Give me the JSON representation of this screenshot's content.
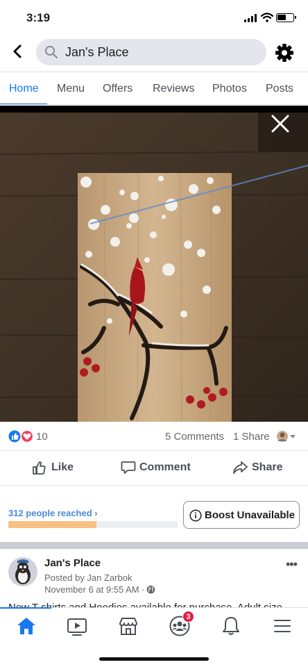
{
  "status_bar": {
    "time": "3:19"
  },
  "header": {
    "search_text": "Jan's Place",
    "icons": [
      "chevron-left-icon",
      "search-icon",
      "gear-icon"
    ]
  },
  "tabs": [
    {
      "label": "Home",
      "active": true
    },
    {
      "label": "Menu",
      "active": false
    },
    {
      "label": "Offers",
      "active": false
    },
    {
      "label": "Reviews",
      "active": false
    },
    {
      "label": "Photos",
      "active": false
    },
    {
      "label": "Posts",
      "active": false
    }
  ],
  "photo": {
    "close_icon": "close-icon"
  },
  "reactions": {
    "count": "10",
    "comments": "5 Comments",
    "shares": "1 Share"
  },
  "actions": {
    "like": "Like",
    "comment": "Comment",
    "share": "Share"
  },
  "reach": {
    "label": "312 people reached",
    "fill_fraction": 0.52,
    "boost_label": "Boost Unavailable",
    "colors": {
      "fill": "#f7c083",
      "label": "#4a8ad8"
    }
  },
  "next_post": {
    "author": "Jan's Place",
    "posted_by": "Posted by Jan Zarbok",
    "date": "November 6 at 9:55 AM ·",
    "text": "New T-shirts and Hoodies available for purchase.  Adult size"
  },
  "bottom_nav": {
    "items": [
      "home-icon",
      "watch-icon",
      "marketplace-icon",
      "groups-icon",
      "notifications-icon",
      "menu-icon"
    ],
    "groups_badge": "3",
    "accent": "#1877f2"
  }
}
